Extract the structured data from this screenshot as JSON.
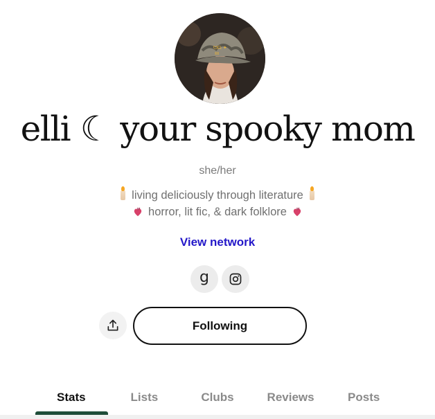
{
  "profile": {
    "display_name": "elli ☾ your spooky mom",
    "pronouns": "she/her",
    "bio_line1": "living deliciously through literature",
    "bio_line2": "horror, lit fic, & dark folklore",
    "view_network": "View network"
  },
  "social": {
    "goodreads_letter": "g",
    "icons": [
      "goodreads-icon",
      "instagram-icon"
    ]
  },
  "actions": {
    "share_icon": "share-icon",
    "follow_label": "Following"
  },
  "tabs": [
    {
      "label": "Stats",
      "active": true
    },
    {
      "label": "Lists",
      "active": false
    },
    {
      "label": "Clubs",
      "active": false
    },
    {
      "label": "Reviews",
      "active": false
    },
    {
      "label": "Posts",
      "active": false
    }
  ],
  "colors": {
    "link": "#2418c9",
    "active_tab_indicator": "#1f4d39"
  }
}
